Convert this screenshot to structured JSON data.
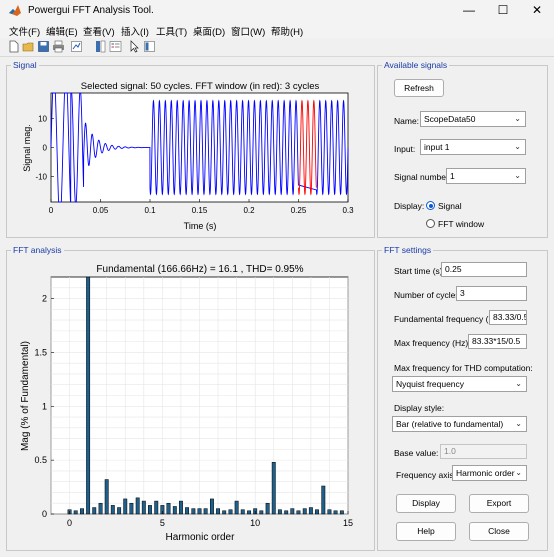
{
  "window": {
    "title": "Powergui FFT Analysis Tool."
  },
  "menu": [
    "文件(F)",
    "编辑(E)",
    "查看(V)",
    "插入(I)",
    "工具(T)",
    "桌面(D)",
    "窗口(W)",
    "帮助(H)"
  ],
  "toolbar": [
    "new-file-icon",
    "open-folder-icon",
    "save-icon",
    "print-icon",
    "link-plot-icon",
    "colorbar-icon",
    "legend-icon",
    "pointer-icon",
    "property-editor-icon"
  ],
  "signal_panel": {
    "title": "Signal",
    "plot_title": "Selected signal: 50 cycles. FFT window (in red): 3 cycles",
    "ylabel": "Signal mag.",
    "xlabel": "Time (s)",
    "xticks": [
      "0",
      "0.05",
      "0.1",
      "0.15",
      "0.2",
      "0.25",
      "0.3"
    ],
    "yticks": [
      "10",
      "0",
      "-10"
    ]
  },
  "available_signals": {
    "title": "Available signals",
    "refresh_label": "Refresh",
    "name_label": "Name:",
    "name_value": "ScopeData50",
    "input_label": "Input:",
    "input_value": "input 1",
    "signal_number_label": "Signal number:",
    "signal_number_value": "1",
    "display_label": "Display:",
    "display_options": [
      "Signal",
      "FFT window"
    ],
    "display_selected": "Signal"
  },
  "fft_panel": {
    "title": "FFT analysis",
    "plot_title": "Fundamental (166.66Hz) = 16.1 , THD= 0.95%",
    "ylabel": "Mag (% of Fundamental)",
    "xlabel": "Harmonic order",
    "xticks": [
      "0",
      "5",
      "10",
      "15"
    ],
    "yticks": [
      "0",
      "0.5",
      "1",
      "1.5",
      "2"
    ]
  },
  "chart_data": {
    "type": "bar",
    "title": "Fundamental (166.66Hz) = 16.1 , THD= 0.95%",
    "xlabel": "Harmonic order",
    "ylabel": "Mag (% of Fundamental)",
    "xlim": [
      -1,
      15
    ],
    "ylim": [
      0,
      2.2
    ],
    "grid": true,
    "x": [
      0,
      0.33,
      0.67,
      1,
      1.33,
      1.67,
      2,
      2.33,
      2.67,
      3,
      3.33,
      3.67,
      4,
      4.33,
      4.67,
      5,
      5.33,
      5.67,
      6,
      6.33,
      6.67,
      7,
      7.33,
      7.67,
      8,
      8.33,
      8.67,
      9,
      9.33,
      9.67,
      10,
      10.33,
      10.67,
      11,
      11.33,
      11.67,
      12,
      12.33,
      12.67,
      13,
      13.33,
      13.67,
      14,
      14.33,
      14.67
    ],
    "values": [
      0.04,
      0.03,
      0.05,
      2.2,
      0.06,
      0.1,
      0.32,
      0.08,
      0.06,
      0.14,
      0.1,
      0.15,
      0.12,
      0.08,
      0.12,
      0.08,
      0.1,
      0.07,
      0.12,
      0.06,
      0.05,
      0.05,
      0.05,
      0.14,
      0.05,
      0.03,
      0.04,
      0.12,
      0.04,
      0.03,
      0.05,
      0.03,
      0.1,
      0.48,
      0.04,
      0.03,
      0.05,
      0.03,
      0.05,
      0.06,
      0.04,
      0.26,
      0.04,
      0.03,
      0.03
    ]
  },
  "fft_settings": {
    "title": "FFT settings",
    "start_time_label": "Start time (s):",
    "start_time_value": "0.25",
    "cycles_label": "Number of cycles:",
    "cycles_value": "3",
    "fund_freq_label": "Fundamental frequency (Hz):",
    "fund_freq_value": "83.33/0.5",
    "max_freq_label": "Max frequency (Hz):",
    "max_freq_value": "83.33*15/0.5",
    "thd_label": "Max frequency for THD computation:",
    "thd_value": "Nyquist frequency",
    "display_style_label": "Display style:",
    "display_style_value": "Bar (relative to fundamental)",
    "base_value_label": "Base value:",
    "base_value": "1.0",
    "freq_axis_label": "Frequency axis:",
    "freq_axis_value": "Harmonic order",
    "display_btn": "Display",
    "export_btn": "Export",
    "help_btn": "Help",
    "close_btn": "Close"
  },
  "colors": {
    "signal": "#0000ff",
    "fft_window": "#ff0000",
    "bar_fill": "#1f5f8b",
    "panel_title": "#1a3aa6",
    "accent": "#0a5bd1"
  }
}
